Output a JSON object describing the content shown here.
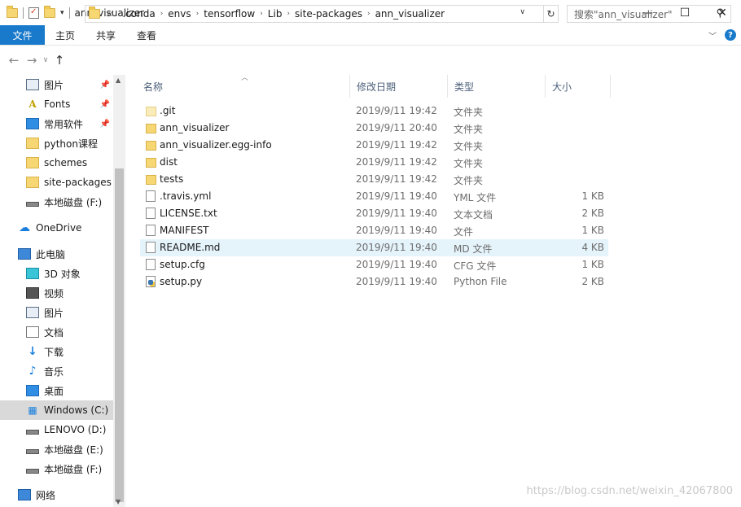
{
  "window": {
    "title": "ann_visualizer",
    "minimize": "—",
    "maximize": "☐",
    "close": "✕"
  },
  "ribbon": {
    "tabs": [
      "文件",
      "主页",
      "共享",
      "查看"
    ]
  },
  "nav": {
    "breadcrumbs": [
      "«",
      ".conda",
      "envs",
      "tensorflow",
      "Lib",
      "site-packages",
      "ann_visualizer"
    ],
    "search_placeholder": "搜索\"ann_visualizer\""
  },
  "sidebar": {
    "items": [
      {
        "label": "图片",
        "icon": "picture-icon",
        "pinned": true
      },
      {
        "label": "Fonts",
        "icon": "font-icon",
        "pinned": true
      },
      {
        "label": "常用软件",
        "icon": "desktop-icon",
        "pinned": true
      },
      {
        "label": "python课程",
        "icon": "folder-icon",
        "pinned": false
      },
      {
        "label": "schemes",
        "icon": "folder-icon",
        "pinned": false
      },
      {
        "label": "site-packages",
        "icon": "folder-icon",
        "pinned": false
      },
      {
        "label": "本地磁盘 (F:)",
        "icon": "drive-icon",
        "pinned": false
      },
      {
        "label": "OneDrive",
        "icon": "cloud-icon",
        "pinned": false
      },
      {
        "label": "此电脑",
        "icon": "computer-icon",
        "pinned": false
      },
      {
        "label": "3D 对象",
        "icon": "3d-objects-icon",
        "pinned": false
      },
      {
        "label": "视频",
        "icon": "video-icon",
        "pinned": false
      },
      {
        "label": "图片",
        "icon": "picture-icon",
        "pinned": false
      },
      {
        "label": "文档",
        "icon": "document-icon",
        "pinned": false
      },
      {
        "label": "下载",
        "icon": "download-icon",
        "pinned": false
      },
      {
        "label": "音乐",
        "icon": "music-icon",
        "pinned": false
      },
      {
        "label": "桌面",
        "icon": "desktop-icon",
        "pinned": false
      },
      {
        "label": "Windows (C:)",
        "icon": "windows-drive-icon",
        "pinned": false,
        "selected": true
      },
      {
        "label": "LENOVO (D:)",
        "icon": "drive-icon",
        "pinned": false
      },
      {
        "label": "本地磁盘 (E:)",
        "icon": "drive-icon",
        "pinned": false
      },
      {
        "label": "本地磁盘 (F:)",
        "icon": "drive-icon",
        "pinned": false
      },
      {
        "label": "网络",
        "icon": "network-icon",
        "pinned": false
      }
    ]
  },
  "list": {
    "headers": [
      "名称",
      "修改日期",
      "类型",
      "大小"
    ],
    "rows": [
      {
        "name": ".git",
        "date": "2019/9/11 19:42",
        "type": "文件夹",
        "size": "",
        "icon": "folder-icon"
      },
      {
        "name": "ann_visualizer",
        "date": "2019/9/11 20:40",
        "type": "文件夹",
        "size": "",
        "icon": "folder-icon"
      },
      {
        "name": "ann_visualizer.egg-info",
        "date": "2019/9/11 19:42",
        "type": "文件夹",
        "size": "",
        "icon": "folder-icon"
      },
      {
        "name": "dist",
        "date": "2019/9/11 19:42",
        "type": "文件夹",
        "size": "",
        "icon": "folder-icon"
      },
      {
        "name": "tests",
        "date": "2019/9/11 19:42",
        "type": "文件夹",
        "size": "",
        "icon": "folder-icon"
      },
      {
        "name": ".travis.yml",
        "date": "2019/9/11 19:40",
        "type": "YML 文件",
        "size": "1 KB",
        "icon": "file-icon"
      },
      {
        "name": "LICENSE.txt",
        "date": "2019/9/11 19:40",
        "type": "文本文档",
        "size": "2 KB",
        "icon": "text-file-icon"
      },
      {
        "name": "MANIFEST",
        "date": "2019/9/11 19:40",
        "type": "文件",
        "size": "1 KB",
        "icon": "file-icon"
      },
      {
        "name": "README.md",
        "date": "2019/9/11 19:40",
        "type": "MD 文件",
        "size": "4 KB",
        "icon": "file-icon",
        "highlighted": true
      },
      {
        "name": "setup.cfg",
        "date": "2019/9/11 19:40",
        "type": "CFG 文件",
        "size": "1 KB",
        "icon": "file-icon"
      },
      {
        "name": "setup.py",
        "date": "2019/9/11 19:40",
        "type": "Python File",
        "size": "2 KB",
        "icon": "python-file-icon"
      }
    ]
  },
  "watermark": "https://blog.csdn.net/weixin_42067800"
}
